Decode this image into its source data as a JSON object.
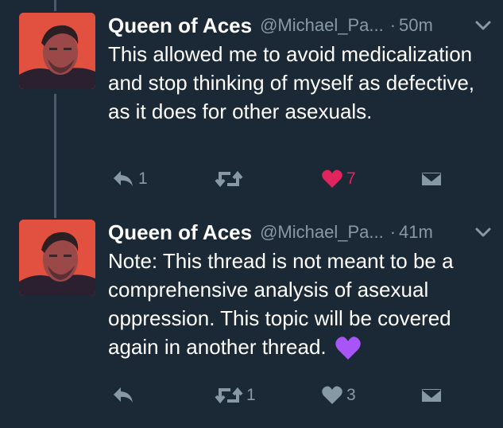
{
  "tweets": [
    {
      "author_name": "Queen of Aces",
      "handle": "@Michael_Pa...",
      "time": "50m",
      "text": "This allowed me to avoid medicalization and stop thinking of myself as defective, as it does for other asexuals.",
      "reply_count": "1",
      "retweet_count": "",
      "like_count": "7",
      "liked": true
    },
    {
      "author_name": "Queen of Aces",
      "handle": "@Michael_Pa...",
      "time": "41m",
      "text": "Note: This thread is not meant to be a comprehensive analysis of asexual oppression. This topic will be covered again in another thread.",
      "reply_count": "",
      "retweet_count": "1",
      "like_count": "3",
      "liked": false,
      "emoji": "purple-heart"
    }
  ],
  "colors": {
    "background": "#1b2836",
    "muted": "#8899a6",
    "like_active": "#e0245e",
    "purple_heart": "#a855f7"
  },
  "icons": [
    "reply-icon",
    "retweet-icon",
    "like-icon",
    "direct-message-icon",
    "chevron-down-icon"
  ]
}
